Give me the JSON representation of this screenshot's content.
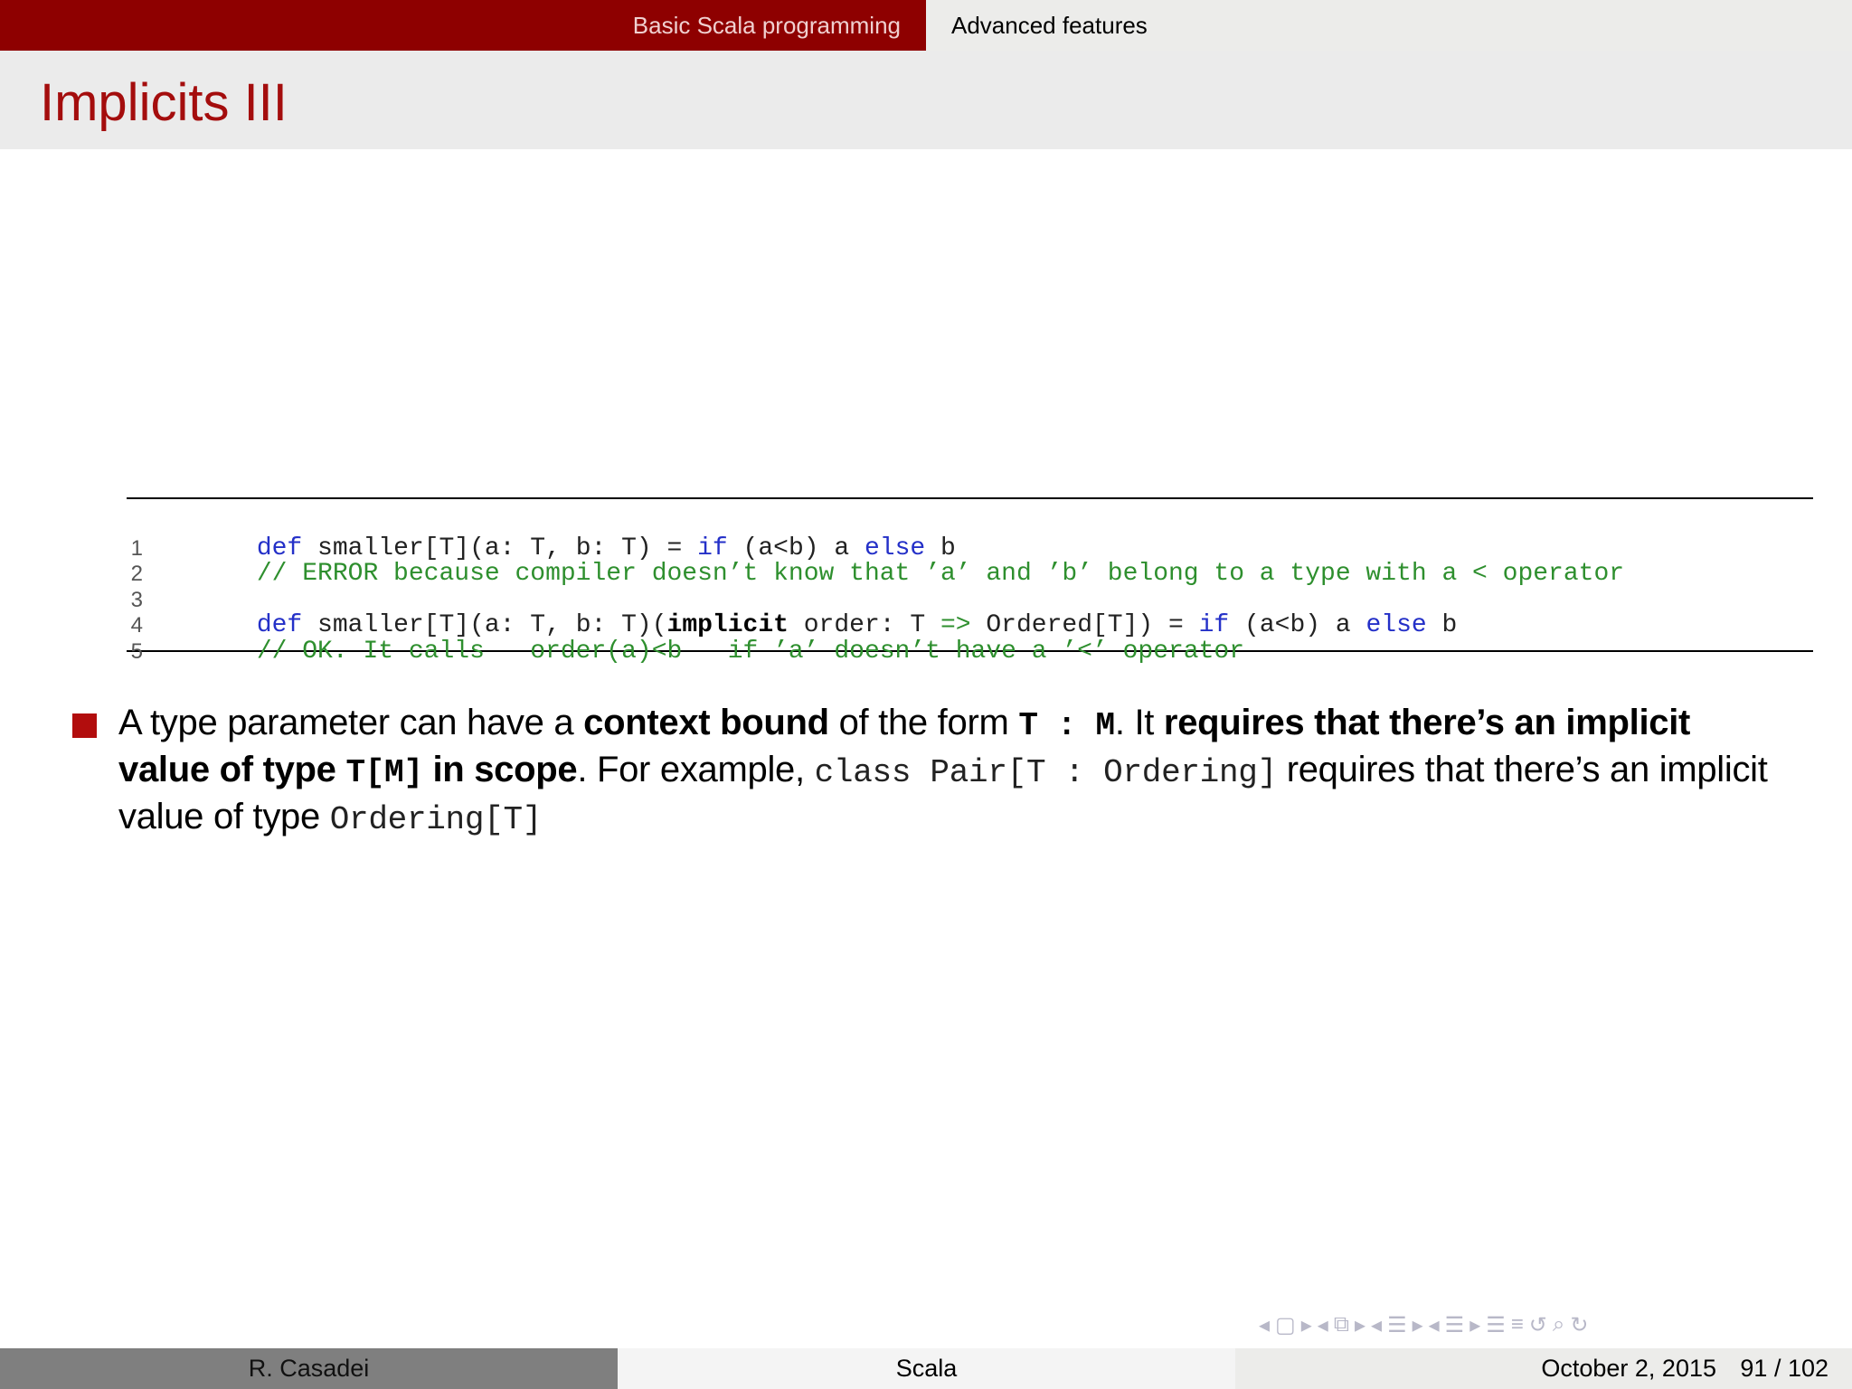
{
  "nav": {
    "sections": [
      "Basic Scala programming",
      "Advanced features"
    ]
  },
  "frame": {
    "title": "Implicits III"
  },
  "code": {
    "lines": [
      {
        "no": "1"
      },
      {
        "no": "2"
      },
      {
        "no": "3"
      },
      {
        "no": "4"
      },
      {
        "no": "5"
      }
    ],
    "l1": {
      "kw1": "def",
      "t1": " smaller[T](a: T, b: T) = ",
      "kw2": "if",
      "t2": " (a<b) a ",
      "kw3": "else",
      "t3": " b"
    },
    "l2": {
      "comment": "// ERROR because compiler doesn’t know that ’a’ and ’b’ belong to a type with a < operator"
    },
    "l4": {
      "kw1": "def",
      "t1": " smaller[T](a: T, b: T)(",
      "kw_bold": "implicit",
      "t2": " order: T ",
      "arrow": "=>",
      "t3": " Ordered[T]) = ",
      "kw2": "if",
      "t4": " (a<b) a ",
      "kw3": "else",
      "t5": " b"
    },
    "l5": {
      "comment": "// OK. It calls   order(a)<b   if ’a’ doesn’t have a ’<’ operator"
    }
  },
  "bullet": {
    "p1": "A type parameter can have a ",
    "b1": "context bound",
    "p2": " of the form ",
    "code1": "T : M",
    "p3": ". It ",
    "b2": "requires that there’s an implicit value of type ",
    "code2": "T[M]",
    "b3": " in scope",
    "p4": ". For example, ",
    "code3": "class Pair[T : Ordering]",
    "p5": " requires that there’s an implicit value of type ",
    "code4": "Ordering[T]"
  },
  "footer": {
    "author": "R. Casadei",
    "title": "Scala",
    "date": "October 2, 2015",
    "page": "91 / 102"
  },
  "icons": [
    "nav-prev-frame-icon",
    "nav-frame-icon",
    "nav-next-frame-icon",
    "nav-prev-subsection-icon",
    "nav-subsection-icon",
    "nav-next-subsection-icon",
    "nav-prev-section-icon",
    "nav-section-icon",
    "nav-next-section-icon",
    "nav-document-icon",
    "nav-back-icon",
    "nav-search-icon",
    "nav-forward-icon"
  ]
}
